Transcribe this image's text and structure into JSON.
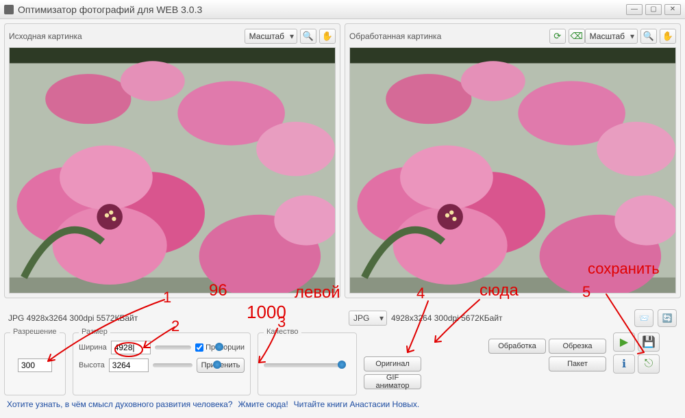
{
  "window": {
    "title": "Оптимизатор фотографий для WEB 3.0.3",
    "minimize": "—",
    "maximize": "▢",
    "close": "✕"
  },
  "left_panel": {
    "title": "Исходная картинка",
    "zoom_select": "Масштаб",
    "mag_icon": "🔍",
    "hand_icon": "✋"
  },
  "right_panel": {
    "title": "Обработанная картинка",
    "refresh_icon": "⟳",
    "clear_icon": "⌫",
    "zoom_select": "Масштаб",
    "mag_icon": "🔍",
    "hand_icon": "✋"
  },
  "status": {
    "left": "JPG 4928x3264 300dpi 5572КБайт",
    "right_fmt": "JPG",
    "right_info": "4928x3264 300dpi 5672КБайт"
  },
  "controls": {
    "resolution": {
      "label": "Разрешение",
      "value": "300"
    },
    "size": {
      "label": "Размер",
      "width_label": "Ширина",
      "width_value": "4928|",
      "height_label": "Высота",
      "height_value": "3264",
      "proportions": "Пропорции",
      "apply": "Применить"
    },
    "quality": {
      "label": "Качество"
    },
    "buttons": {
      "original": "Оригинал",
      "process": "Обработка",
      "gif": "GIF аниматор",
      "crop": "Обрезка",
      "batch": "Пакет"
    }
  },
  "icons": {
    "open": "📨",
    "reload": "🔄",
    "run": "▶",
    "save": "💾",
    "info": "ℹ",
    "exit": "⎋"
  },
  "footer": {
    "t1": "Хотите узнать, в чём смысл духовного развития человека?",
    "t2": "Жмите сюда!",
    "t3": "Читайте книги Анастасии Новых.",
    "sep": " "
  },
  "annotations": {
    "a1": "1",
    "a2": "2",
    "a3": "3",
    "a4": "4",
    "a5": "5",
    "n96": "96",
    "n1000": "1000",
    "w_left": "левой",
    "w_here": "сюда",
    "w_save": "сохранить"
  }
}
